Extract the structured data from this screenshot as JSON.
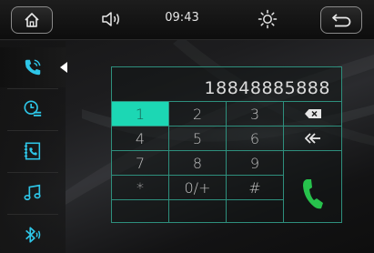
{
  "status_bar": {
    "time": "09:43",
    "home_icon": "home-icon",
    "volume_icon": "speaker-volume-icon",
    "brightness_icon": "brightness-sun-icon",
    "back_icon": "return-arrow-icon"
  },
  "sidebar": {
    "active_item": "phone",
    "items": [
      {
        "id": "phone",
        "icon": "phone-call-icon"
      },
      {
        "id": "history",
        "icon": "call-history-icon"
      },
      {
        "id": "contacts",
        "icon": "contacts-book-icon"
      },
      {
        "id": "music",
        "icon": "music-note-icon"
      },
      {
        "id": "bluetooth",
        "icon": "bluetooth-audio-icon"
      }
    ]
  },
  "dialpad": {
    "number": "18848885888",
    "pressed_key": "1",
    "rows": [
      [
        "1",
        "2",
        "3"
      ],
      [
        "4",
        "5",
        "6"
      ],
      [
        "7",
        "8",
        "9"
      ],
      [
        "*",
        "0/+",
        "#"
      ]
    ],
    "backspace_icon": "backspace-icon",
    "clear_icon": "double-arrow-clear-icon",
    "call_icon": "green-call-icon"
  },
  "colors": {
    "accent": "#1cd7b4",
    "grid_line": "#2e8f7d",
    "call_green": "#27c24c",
    "sidebar_icon": "#2ec6e8"
  }
}
